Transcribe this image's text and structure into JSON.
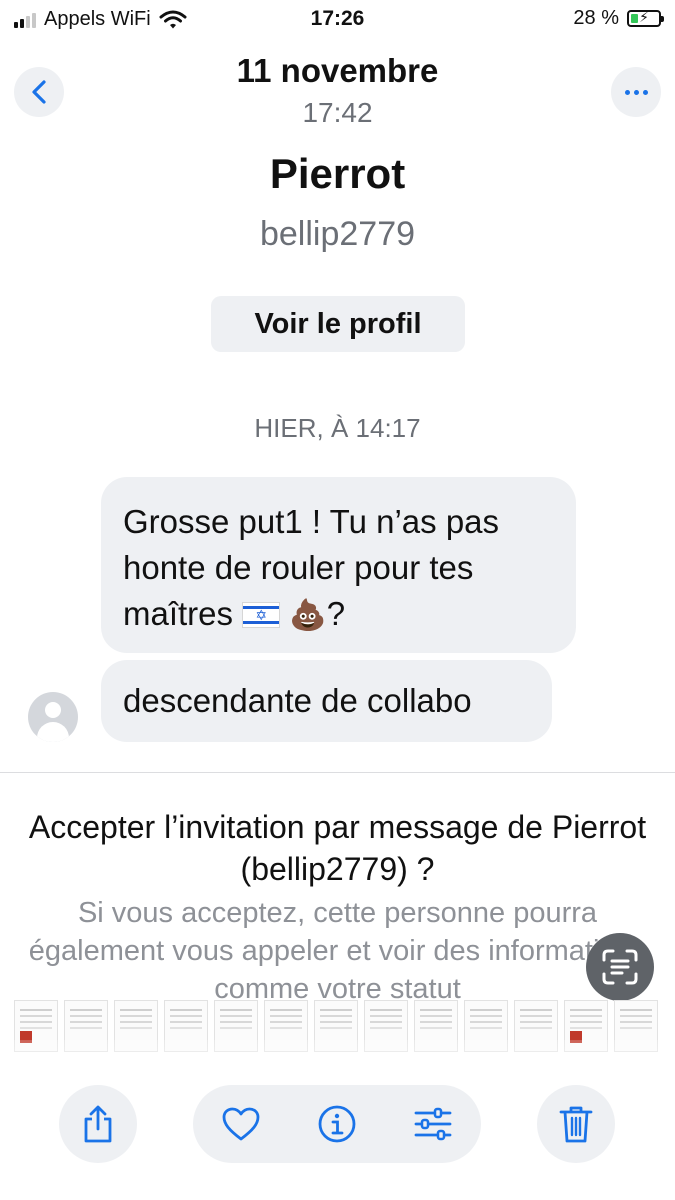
{
  "status_bar": {
    "carrier": "Appels WiFi",
    "time": "17:26",
    "battery": "28 %",
    "battery_level": 0.28
  },
  "header": {
    "date": "11 novembre",
    "time": "17:42",
    "back_icon": "chevron-left-icon",
    "more_icon": "more-dots-icon"
  },
  "contact": {
    "name": "Pierrot",
    "handle": "bellip2779",
    "profile_button": "Voir le profil"
  },
  "conversation": {
    "day_separator": "HIER, À 14:17",
    "messages": [
      {
        "text_before": "Grosse put1 ! Tu n’as pas honte de rouler pour tes maîtres",
        "emojis": [
          "israel-flag-emoji",
          "pile-of-poo-emoji"
        ],
        "text_after": "?"
      },
      {
        "text": "descendante de collabo"
      }
    ]
  },
  "invitation": {
    "title": "Accepter l’invitation par message de Pierrot (bellip2779) ?",
    "body": "Si vous acceptez, cette personne pourra également vous appeler et voir des informations comme votre statut"
  },
  "toolbar": {
    "share_icon": "share-icon",
    "like_icon": "heart-icon",
    "info_icon": "info-icon",
    "adjust_icon": "sliders-icon",
    "trash_icon": "trash-icon"
  },
  "colors": {
    "accent": "#1a73e8",
    "bubble": "#eef0f3",
    "secondary_text": "#6b6f76",
    "battery_fill": "#34c759"
  }
}
